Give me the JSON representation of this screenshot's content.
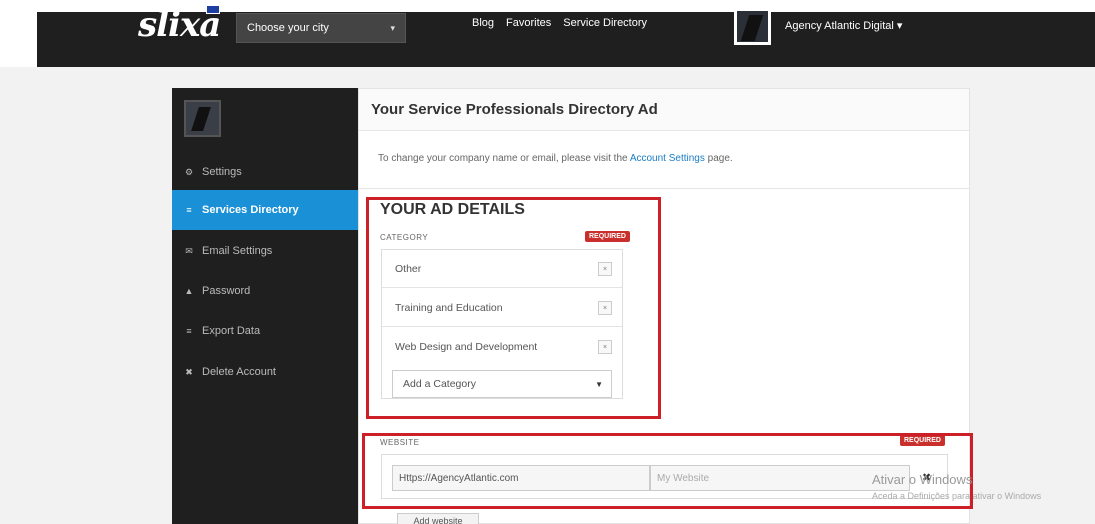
{
  "nav": {
    "logo": "slixa",
    "city_select": "Choose your city",
    "links": [
      "Blog",
      "Favorites",
      "Service Directory"
    ],
    "account_label": "Agency Atlantic Digital ▾"
  },
  "sidebar": {
    "items": [
      {
        "icon": "gear-icon",
        "glyph": "⚙",
        "label": "Settings"
      },
      {
        "icon": "list-icon",
        "glyph": "≡",
        "label": "Services Directory"
      },
      {
        "icon": "envelope-icon",
        "glyph": "✉",
        "label": "Email Settings"
      },
      {
        "icon": "lock-icon",
        "glyph": "▲",
        "label": "Password"
      },
      {
        "icon": "database-icon",
        "glyph": "≡",
        "label": "Export Data"
      },
      {
        "icon": "close-icon",
        "glyph": "✖",
        "label": "Delete Account"
      }
    ],
    "active_index": 1
  },
  "main": {
    "title": "Your Service Professionals Directory Ad",
    "notice_prefix": "To change your company name or email, please visit the ",
    "notice_link": "Account Settings",
    "notice_suffix": " page.",
    "ad_details_title": "YOUR AD DETAILS",
    "category": {
      "label": "CATEGORY",
      "required": "REQUIRED",
      "items": [
        "Other",
        "Training and Education",
        "Web Design and Development"
      ],
      "remove_glyph": "×",
      "add_placeholder": "Add a Category"
    },
    "website": {
      "label": "WEBSITE",
      "required": "REQUIRED",
      "url_value": "Https://AgencyAtlantic.com",
      "name_placeholder": "My Website",
      "remove_glyph": "✖",
      "add_button": "Add website"
    }
  },
  "watermark": {
    "line1": "Ativar o Windows",
    "line2": "Aceda a Definições para ativar o Windows"
  },
  "colors": {
    "accent_blue": "#1a90d6",
    "highlight_red": "#cc1f27",
    "required_red": "#c9302c"
  }
}
